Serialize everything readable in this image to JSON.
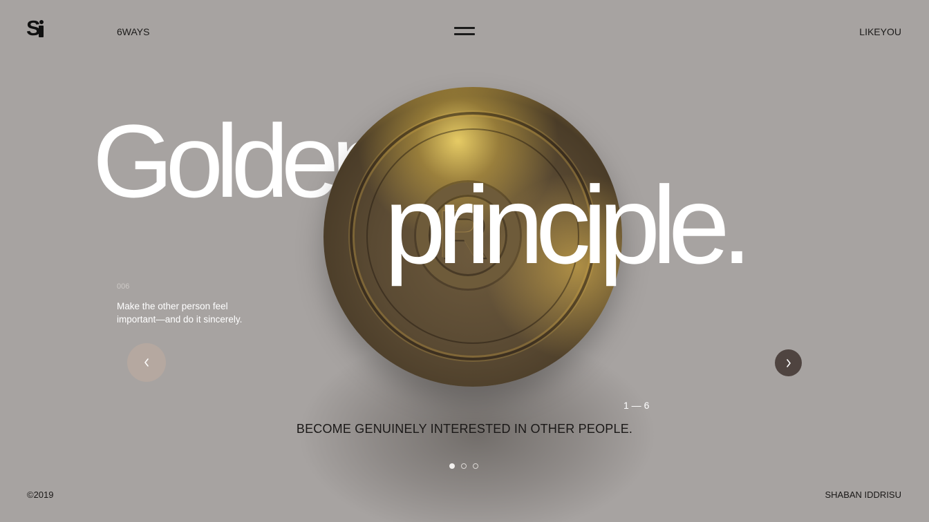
{
  "header": {
    "logo_text": "Si",
    "nav_left": "6WAYS",
    "nav_right": "LIKEYOU"
  },
  "hero": {
    "headline_line1": "Golden",
    "headline_line2": "principle.",
    "coin_letter": "R",
    "index": "006",
    "quote": "Make the other person feel important—and do it sincerely.",
    "counter": "1 — 6",
    "caption": "BECOME GENUINELY INTERESTED IN OTHER PEOPLE."
  },
  "carousel": {
    "dots": 3,
    "active_dot": 1
  },
  "footer": {
    "copyright": "©2019",
    "author": "SHABAN IDDRISU"
  },
  "colors": {
    "background": "#a7a3a1",
    "text_dark": "#1a1817",
    "headline": "#ffffff",
    "coin_gold": "#c9a247",
    "next_button": "#4f4440",
    "prev_button": "#b5a8a0"
  },
  "icons": {
    "menu": "hamburger-icon",
    "prev": "chevron-left-icon",
    "next": "chevron-right-icon"
  }
}
